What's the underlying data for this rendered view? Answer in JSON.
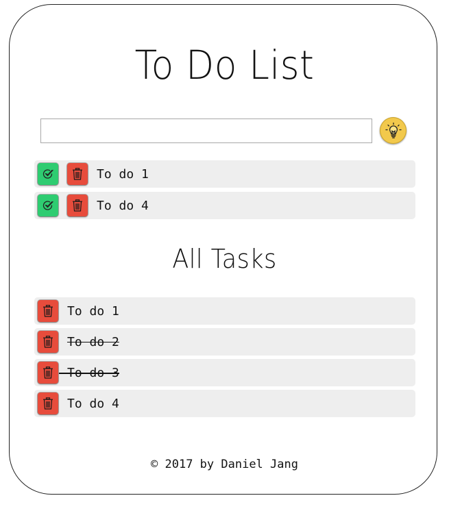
{
  "header": {
    "title": "To Do List"
  },
  "input": {
    "value": "",
    "placeholder": ""
  },
  "add_button": {
    "icon": "lightbulb-icon",
    "color": "#f2c94c"
  },
  "active_tasks": [
    {
      "label": "To do 1"
    },
    {
      "label": "To do 4"
    }
  ],
  "all_tasks": {
    "heading": "All Tasks",
    "items": [
      {
        "label": "To do 1",
        "completed": false
      },
      {
        "label": "To do 2",
        "completed": true
      },
      {
        "label": "To do 3",
        "completed": true
      },
      {
        "label": "To do 4",
        "completed": false
      }
    ]
  },
  "colors": {
    "done_button": "#2ecc71",
    "delete_button": "#e74c3c",
    "row_background": "#eeeeee"
  },
  "footer": {
    "text": "© 2017 by Daniel Jang"
  }
}
